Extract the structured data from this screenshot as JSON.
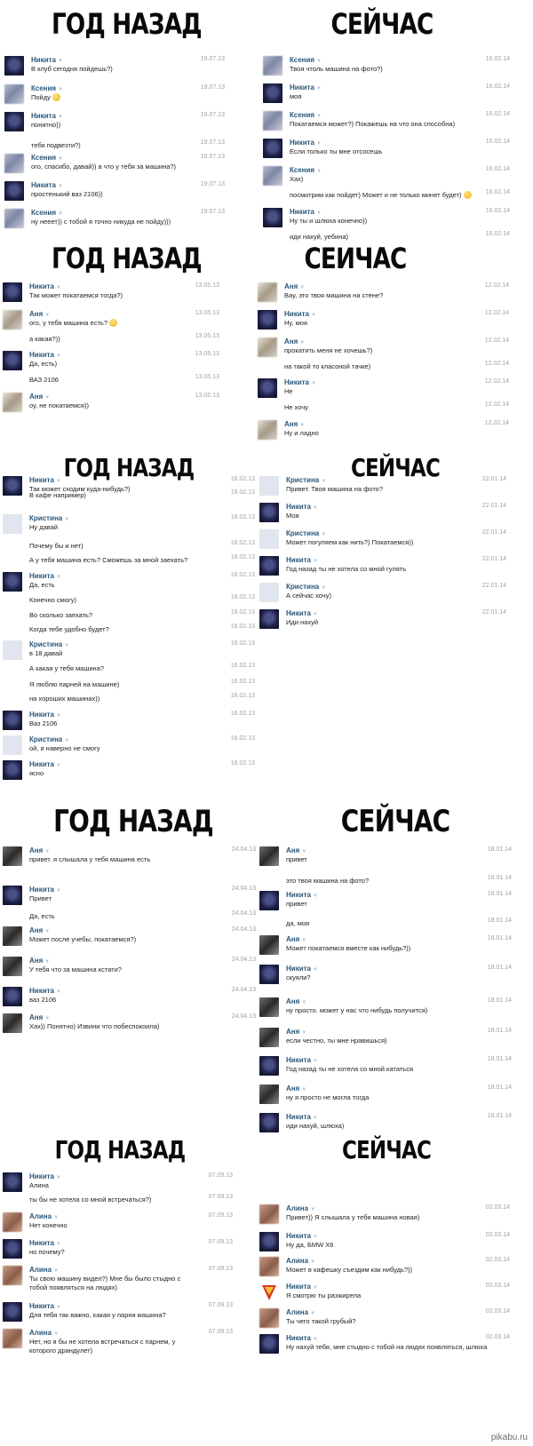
{
  "headings": {
    "ago": "ГОД НАЗАД",
    "now": "СЕЙЧАС",
    "now_alt": "СЕИЧАС"
  },
  "panels": {
    "p1_left": [
      {
        "name": "Никита",
        "date": "19.07.13",
        "text": "В клуб сегодня пойдешь?)",
        "avatar": "nikita"
      },
      {
        "name": "Ксения",
        "date": "19.07.13",
        "text": "Пойду",
        "avatar": "ksenia",
        "smile": true
      },
      {
        "name": "Никита",
        "date": "19.07.13",
        "text": "понятно))",
        "avatar": "nikita"
      },
      {
        "date": "19.07.13",
        "text": "тебя подвезти?)"
      },
      {
        "name": "Ксения",
        "date": "19.07.13",
        "text": "ого, спасибо, давай)) а что у тебя за машина?)",
        "avatar": "ksenia"
      },
      {
        "name": "Никита",
        "date": "19.07.13",
        "text": "простенький ваз 2106))",
        "avatar": "nikita"
      },
      {
        "name": "Ксения",
        "date": "19.07.13",
        "text": "ну нееет)) с тобой я точно никуда не пойду)))",
        "avatar": "ksenia"
      }
    ],
    "p1_right": [
      {
        "name": "Ксения",
        "date": "16.02.14",
        "text": "Твоя чтоль машина на фото?)",
        "avatar": "ksenia"
      },
      {
        "name": "Никита",
        "date": "16.02.14",
        "text": "моя",
        "avatar": "nikita"
      },
      {
        "name": "Ксения",
        "date": "16.02.14",
        "text": "Покатаемся может?) Покажешь на что она способна)",
        "avatar": "ksenia"
      },
      {
        "name": "Никита",
        "date": "16.02.14",
        "text": "Если только ты мне отсосешь",
        "avatar": "nikita"
      },
      {
        "name": "Ксения",
        "date": "16.02.14",
        "text": "Хах)",
        "avatar": "ksenia"
      },
      {
        "date": "16.02.14",
        "text": "посмотрим как пойдет) Может и не только минет будет)",
        "smile": true
      },
      {
        "name": "Никита",
        "date": "16.02.14",
        "text": "Ну ты и шлюха конечно))",
        "avatar": "nikita"
      },
      {
        "date": "16.02.14",
        "text": "иди нахуй, уебина)"
      }
    ],
    "p2_left": [
      {
        "name": "Никита",
        "date": "13.05.13",
        "text": "Так может покатаемся тогда?)",
        "avatar": "nikita"
      },
      {
        "name": "Аня",
        "date": "13.05.13",
        "text": "ого, у тебя машина есть?",
        "avatar": "anya1",
        "smile": true
      },
      {
        "date": "13.05.13",
        "text": "а какая?))"
      },
      {
        "name": "Никита",
        "date": "13.05.13",
        "text": "Да, есть)",
        "avatar": "nikita"
      },
      {
        "date": "13.05.13",
        "text": "ВАЗ 2106"
      },
      {
        "name": "Аня",
        "date": "13.05.13",
        "text": "оу, не покатаемся))",
        "avatar": "anya1"
      }
    ],
    "p2_right": [
      {
        "name": "Аня",
        "date": "12.02.14",
        "text": "Вау, это твоя машина на стене?",
        "avatar": "anya1"
      },
      {
        "name": "Никита",
        "date": "12.02.14",
        "text": "Ну, моя",
        "avatar": "nikita"
      },
      {
        "name": "Аня",
        "date": "12.02.14",
        "text": "прокатить меня не хочешь?)",
        "avatar": "anya1"
      },
      {
        "date": "12.02.14",
        "text": "на такой то класоной тачке)"
      },
      {
        "name": "Никита",
        "date": "12.02.14",
        "text": "Не",
        "avatar": "nikita"
      },
      {
        "date": "12.02.14",
        "text": "Не хочу"
      },
      {
        "name": "Аня",
        "date": "12.02.14",
        "text": "Ну и ладно",
        "avatar": "anya1"
      }
    ],
    "p3_left": [
      {
        "name": "Никита",
        "date": "16.02.13",
        "text": "Так может сходим куда-нибудь?)",
        "avatar": "nikita"
      },
      {
        "date": "16.02.13",
        "text": "В кафе например)"
      },
      {
        "name": "Кристина",
        "date": "16.02.13",
        "text": "Ну давай",
        "avatar": "kristina"
      },
      {
        "date": "16.02.13",
        "text": "Почему бы и нет)"
      },
      {
        "date": "16.02.13",
        "text": "А у тебя машина есть? Сможешь за мной заехать?"
      },
      {
        "name": "Никита",
        "date": "16.02.13",
        "text": "Да, есть",
        "avatar": "nikita"
      },
      {
        "date": "16.02.13",
        "text": "Конечно смогу)"
      },
      {
        "date": "16.02.13",
        "text": "Во сколько заехать?"
      },
      {
        "date": "16.02.13",
        "text": "Когда тебе удобно будет?"
      },
      {
        "name": "Кристина",
        "date": "16.02.13",
        "text": "в 18 давай",
        "avatar": "kristina"
      },
      {
        "date": "16.02.13",
        "text": "А какая у тебя машина?"
      },
      {
        "date": "16.02.13",
        "text": "Я люблю парней на машине)"
      },
      {
        "date": "16.02.13",
        "text": "на хороших машинах))"
      },
      {
        "name": "Никита",
        "date": "16.02.13",
        "text": "Ваз 2106",
        "avatar": "nikita"
      },
      {
        "name": "Кристина",
        "date": "16.02.13",
        "text": "ой, я наверно не смогу",
        "avatar": "kristina"
      },
      {
        "name": "Никита",
        "date": "16.02.13",
        "text": "ясно",
        "avatar": "nikita"
      }
    ],
    "p3_right": [
      {
        "name": "Кристина",
        "date": "22.01.14",
        "text": "Привет. Твоя машина на фото?",
        "avatar": "kristina"
      },
      {
        "name": "Никита",
        "date": "22.01.14",
        "text": "Моя",
        "avatar": "nikita"
      },
      {
        "name": "Кристина",
        "date": "22.01.14",
        "text": "Может погуляем как нить?) Покатаемся))",
        "avatar": "kristina"
      },
      {
        "name": "Никита",
        "date": "22.01.14",
        "text": "Год назад ты не хотела со мной гулять",
        "avatar": "nikita"
      },
      {
        "name": "Кристина",
        "date": "22.01.14",
        "text": "А сейчас хочу)",
        "avatar": "kristina"
      },
      {
        "name": "Никита",
        "date": "22.01.14",
        "text": "Иди нахуй",
        "avatar": "nikita"
      }
    ],
    "p4_left": [
      {
        "name": "Аня",
        "date": "24.04.13",
        "text": "привет. я слышала у тебя машина есть",
        "avatar": "anya3"
      },
      {
        "name": "Никита",
        "date": "24.04.13",
        "text": "Привет",
        "avatar": "nikita"
      },
      {
        "date": "24.04.13",
        "text": "Да, есть"
      },
      {
        "name": "Аня",
        "date": "24.04.13",
        "text": "Может после учебы, покатаемся?)",
        "avatar": "anya3"
      },
      {
        "name": "Аня",
        "date": "24.04.13",
        "text": "У тебя что за машина кстати?",
        "avatar": "anya3"
      },
      {
        "name": "Никита",
        "date": "24.04.13",
        "text": "ваз 2106",
        "avatar": "nikita"
      },
      {
        "name": "Аня",
        "date": "24.04.13",
        "text": "Хах)) Понятно) Извини что побеспокоила)",
        "avatar": "anya3"
      }
    ],
    "p4_right": [
      {
        "name": "Аня",
        "date": "18.01.14",
        "text": "привет",
        "avatar": "anya3"
      },
      {
        "date": "18.01.14",
        "text": "это твоя машина на фото?"
      },
      {
        "name": "Никита",
        "date": "18.01.14",
        "text": "привет",
        "avatar": "nikita"
      },
      {
        "date": "18.01.14",
        "text": "да, моя"
      },
      {
        "name": "Аня",
        "date": "18.01.14",
        "text": "Может покатаемся вместе как нибудь?))",
        "avatar": "anya3"
      },
      {
        "name": "Никита",
        "date": "18.01.14",
        "text": "скуяли?",
        "avatar": "nikita"
      },
      {
        "name": "Аня",
        "date": "18.01.14",
        "text": "ну просто. может у нас что нибудь получится)",
        "avatar": "anya3"
      },
      {
        "name": "Аня",
        "date": "18.01.14",
        "text": "если честно, ты мне нравишься)",
        "avatar": "anya3"
      },
      {
        "name": "Никита",
        "date": "18.01.14",
        "text": "Год назад ты не хотела со мной кататься",
        "avatar": "nikita"
      },
      {
        "name": "Аня",
        "date": "18.01.14",
        "text": "ну я просто не могла тогда",
        "avatar": "anya3"
      },
      {
        "name": "Никита",
        "date": "18.01.14",
        "text": "иди нахуй, шлюха)",
        "avatar": "nikita"
      }
    ],
    "p5_left": [
      {
        "name": "Никита",
        "date": "07.09.13",
        "text": "Алина",
        "avatar": "nikita"
      },
      {
        "date": "07.09.13",
        "text": "ты бы не хотела со мной встречаться?)"
      },
      {
        "name": "Алина",
        "date": "07.09.13",
        "text": "Нет конечно",
        "avatar": "alina"
      },
      {
        "name": "Никита",
        "date": "07.09.13",
        "text": "но почему?",
        "avatar": "nikita"
      },
      {
        "name": "Алина",
        "date": "07.09.13",
        "text": "Ты свою машину видел?) Мне бы было стыдно с тобой появляться на людях)",
        "avatar": "alina",
        "wrap": true
      },
      {
        "name": "Никита",
        "date": "07.09.13",
        "text": "Для тебя так важно, какая у парня машина?",
        "avatar": "nikita"
      },
      {
        "name": "Алина",
        "date": "07.09.13",
        "text": "Нет, но я бы не хотела встречаться с парнем, у которого драндулет)",
        "avatar": "alina",
        "wrap": true
      }
    ],
    "p5_right": [
      {
        "name": "Алина",
        "date": "02.03.14",
        "text": "Привет)) Я слышала у тебя машина новая)",
        "avatar": "alina"
      },
      {
        "name": "Никита",
        "date": "02.03.14",
        "text": "Ну да, БМW Х6",
        "avatar": "nikita"
      },
      {
        "name": "Алина",
        "date": "02.03.14",
        "text": "Может в кафешку съездим как нибудь?))",
        "avatar": "alina"
      },
      {
        "name": "Никита",
        "date": "02.03.14",
        "text": "Я смотрю ты разжирела",
        "avatar": "super"
      },
      {
        "name": "Алина",
        "date": "02.03.14",
        "text": "Ты чего такой грубый?",
        "avatar": "alina"
      },
      {
        "name": "Никита",
        "date": "02.03.14",
        "text": "Ну нахуй тебя, мне стыдно с тобой на людях появляться, шлюха",
        "avatar": "nikita"
      }
    ]
  },
  "watermark": "pikabu.ru"
}
